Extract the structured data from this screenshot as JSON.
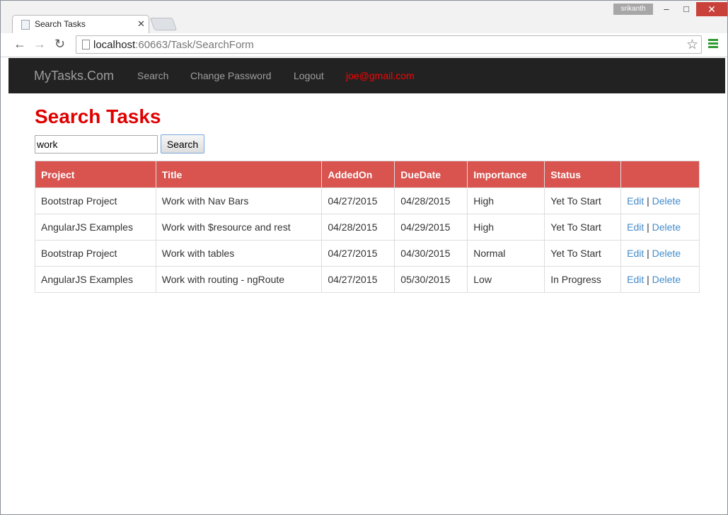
{
  "browser": {
    "user": "srikanth",
    "tab_title": "Search Tasks",
    "url_host": "localhost",
    "url_rest": ":60663/Task/SearchForm"
  },
  "navbar": {
    "brand": "MyTasks.Com",
    "links": [
      "Search",
      "Change Password",
      "Logout"
    ],
    "user_email": "joe@gmail.com"
  },
  "page": {
    "title": "Search Tasks",
    "search_value": "work",
    "search_button": "Search"
  },
  "table": {
    "headers": [
      "Project",
      "Title",
      "AddedOn",
      "DueDate",
      "Importance",
      "Status",
      ""
    ],
    "rows": [
      [
        "Bootstrap Project",
        "Work with Nav Bars",
        "04/27/2015",
        "04/28/2015",
        "High",
        "Yet To Start"
      ],
      [
        "AngularJS Examples",
        "Work with $resource and rest",
        "04/28/2015",
        "04/29/2015",
        "High",
        "Yet To Start"
      ],
      [
        "Bootstrap Project",
        "Work with tables",
        "04/27/2015",
        "04/30/2015",
        "Normal",
        "Yet To Start"
      ],
      [
        "AngularJS Examples",
        "Work with routing - ngRoute",
        "04/27/2015",
        "05/30/2015",
        "Low",
        "In Progress"
      ]
    ],
    "edit_label": "Edit",
    "separator": "|",
    "delete_label": "Delete"
  },
  "colors": {
    "accent": "#d9534f",
    "title": "#e00000",
    "navbar": "#222222",
    "link": "#428bca"
  }
}
